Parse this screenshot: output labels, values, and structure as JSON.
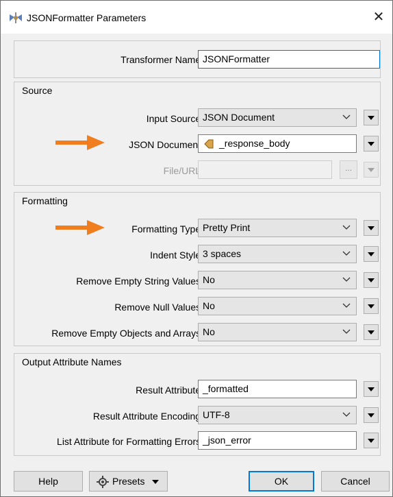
{
  "window": {
    "title": "JSONFormatter Parameters",
    "close_glyph": "✕"
  },
  "transformer_name": {
    "label": "Transformer Name:",
    "value": "JSONFormatter"
  },
  "source": {
    "group_title": "Source",
    "input_source": {
      "label": "Input Source:",
      "value": "JSON Document"
    },
    "json_document": {
      "label": "JSON Document:",
      "value": "_response_body"
    },
    "file_url": {
      "label": "File/URL:",
      "value": "",
      "browse_label": "..."
    }
  },
  "formatting": {
    "group_title": "Formatting",
    "formatting_type": {
      "label": "Formatting Type:",
      "value": "Pretty Print"
    },
    "indent_style": {
      "label": "Indent Style:",
      "value": "3 spaces"
    },
    "remove_empty_strings": {
      "label": "Remove Empty String Values:",
      "value": "No"
    },
    "remove_null_values": {
      "label": "Remove Null Values:",
      "value": "No"
    },
    "remove_empty_objects": {
      "label": "Remove Empty Objects and Arrays:",
      "value": "No"
    }
  },
  "output": {
    "group_title": "Output Attribute Names",
    "result_attribute": {
      "label": "Result Attribute:",
      "value": "_formatted"
    },
    "result_encoding": {
      "label": "Result Attribute Encoding:",
      "value": "UTF-8"
    },
    "list_errors": {
      "label": "List Attribute for Formatting Errors:",
      "value": "_json_error"
    }
  },
  "buttons": {
    "help": "Help",
    "presets": "Presets",
    "ok": "OK",
    "cancel": "Cancel"
  },
  "colors": {
    "annotation_arrow": "#f07d1e",
    "focus_border": "#0078d7",
    "attribute_icon": "#c58a2c"
  }
}
